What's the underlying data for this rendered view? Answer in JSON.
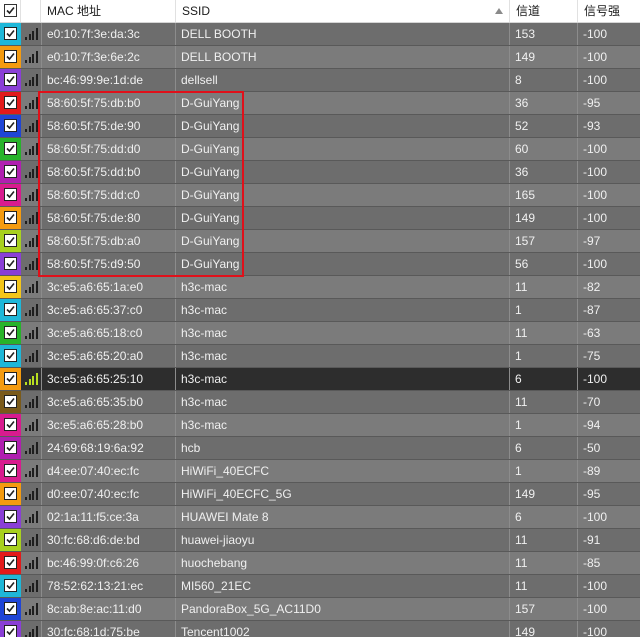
{
  "header": {
    "mac_label": "MAC 地址",
    "ssid_label": "SSID",
    "channel_label": "信道",
    "signal_label": "信号强"
  },
  "colors": {
    "selection_box": "#e0101a",
    "row_selected": "#2d2d2d"
  },
  "rows": [
    {
      "color": "#1fb7d8",
      "mac": "e0:10:7f:3e:da:3c",
      "ssid": "DELL BOOTH",
      "channel": "153",
      "signal": "-100",
      "bars": 4
    },
    {
      "color": "#f49b10",
      "mac": "e0:10:7f:3e:6e:2c",
      "ssid": "DELL BOOTH",
      "channel": "149",
      "signal": "-100",
      "bars": 4
    },
    {
      "color": "#8a3fd6",
      "mac": "bc:46:99:9e:1d:de",
      "ssid": "dellsell",
      "channel": "8",
      "signal": "-100",
      "bars": 4
    },
    {
      "color": "#e21a1a",
      "mac": "58:60:5f:75:db:b0",
      "ssid": "D-GuiYang",
      "channel": "36",
      "signal": "-95",
      "bars": 4
    },
    {
      "color": "#1f45d6",
      "mac": "58:60:5f:75:de:90",
      "ssid": "D-GuiYang",
      "channel": "52",
      "signal": "-93",
      "bars": 4
    },
    {
      "color": "#27b32a",
      "mac": "58:60:5f:75:dd:d0",
      "ssid": "D-GuiYang",
      "channel": "60",
      "signal": "-100",
      "bars": 4
    },
    {
      "color": "#b01fb0",
      "mac": "58:60:5f:75:dd:b0",
      "ssid": "D-GuiYang",
      "channel": "36",
      "signal": "-100",
      "bars": 4
    },
    {
      "color": "#d81b8e",
      "mac": "58:60:5f:75:dd:c0",
      "ssid": "D-GuiYang",
      "channel": "165",
      "signal": "-100",
      "bars": 4
    },
    {
      "color": "#f49b10",
      "mac": "58:60:5f:75:de:80",
      "ssid": "D-GuiYang",
      "channel": "149",
      "signal": "-100",
      "bars": 4
    },
    {
      "color": "#a8d11f",
      "mac": "58:60:5f:75:db:a0",
      "ssid": "D-GuiYang",
      "channel": "157",
      "signal": "-97",
      "bars": 4
    },
    {
      "color": "#8a3fd6",
      "mac": "58:60:5f:75:d9:50",
      "ssid": "D-GuiYang",
      "channel": "56",
      "signal": "-100",
      "bars": 4
    },
    {
      "color": "#f4c61a",
      "mac": "3c:e5:a6:65:1a:e0",
      "ssid": "h3c-mac",
      "channel": "11",
      "signal": "-82",
      "bars": 4
    },
    {
      "color": "#1fb7d8",
      "mac": "3c:e5:a6:65:37:c0",
      "ssid": "h3c-mac",
      "channel": "1",
      "signal": "-87",
      "bars": 4
    },
    {
      "color": "#27b32a",
      "mac": "3c:e5:a6:65:18:c0",
      "ssid": "h3c-mac",
      "channel": "11",
      "signal": "-63",
      "bars": 4
    },
    {
      "color": "#1fb7d8",
      "mac": "3c:e5:a6:65:20:a0",
      "ssid": "h3c-mac",
      "channel": "1",
      "signal": "-75",
      "bars": 4
    },
    {
      "color": "#f49b10",
      "mac": "3c:e5:a6:65:25:10",
      "ssid": "h3c-mac",
      "channel": "6",
      "signal": "-100",
      "bars": 4,
      "selected": true
    },
    {
      "color": "#7a5a1a",
      "mac": "3c:e5:a6:65:35:b0",
      "ssid": "h3c-mac",
      "channel": "11",
      "signal": "-70",
      "bars": 4
    },
    {
      "color": "#d81b8e",
      "mac": "3c:e5:a6:65:28:b0",
      "ssid": "h3c-mac",
      "channel": "1",
      "signal": "-94",
      "bars": 4
    },
    {
      "color": "#b01fb0",
      "mac": "24:69:68:19:6a:92",
      "ssid": "hcb",
      "channel": "6",
      "signal": "-50",
      "bars": 4
    },
    {
      "color": "#d81b8e",
      "mac": "d4:ee:07:40:ec:fc",
      "ssid": "HiWiFi_40ECFC",
      "channel": "1",
      "signal": "-89",
      "bars": 4
    },
    {
      "color": "#f49b10",
      "mac": "d0:ee:07:40:ec:fc",
      "ssid": "HiWiFi_40ECFC_5G",
      "channel": "149",
      "signal": "-95",
      "bars": 4
    },
    {
      "color": "#8a3fd6",
      "mac": "02:1a:11:f5:ce:3a",
      "ssid": "HUAWEI Mate 8",
      "channel": "6",
      "signal": "-100",
      "bars": 4
    },
    {
      "color": "#a8d11f",
      "mac": "30:fc:68:d6:de:bd",
      "ssid": "huawei-jiaoyu",
      "channel": "11",
      "signal": "-91",
      "bars": 4
    },
    {
      "color": "#e21a1a",
      "mac": "bc:46:99:0f:c6:26",
      "ssid": "huochebang",
      "channel": "11",
      "signal": "-85",
      "bars": 4
    },
    {
      "color": "#1fb7d8",
      "mac": "78:52:62:13:21:ec",
      "ssid": "MI560_21EC",
      "channel": "11",
      "signal": "-100",
      "bars": 4
    },
    {
      "color": "#1f45d6",
      "mac": "8c:ab:8e:ac:11:d0",
      "ssid": "PandoraBox_5G_AC11D0",
      "channel": "157",
      "signal": "-100",
      "bars": 4
    },
    {
      "color": "#8a3fd6",
      "mac": "30:fc:68:1d:75:be",
      "ssid": "Tencent1002",
      "channel": "149",
      "signal": "-100",
      "bars": 4
    }
  ]
}
